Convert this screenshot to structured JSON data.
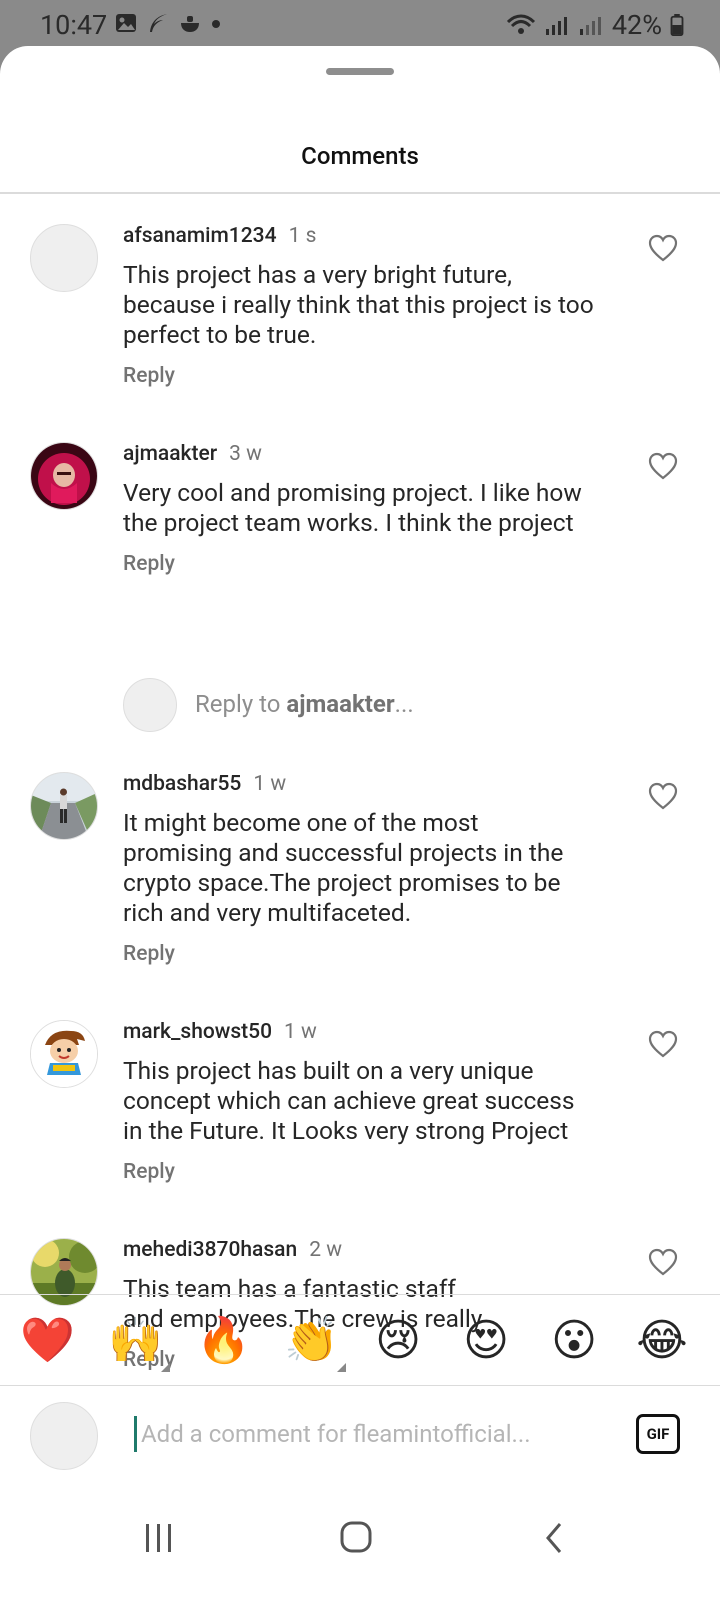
{
  "status_bar": {
    "time": "10:47",
    "battery": "42%"
  },
  "sheet": {
    "title": "Comments"
  },
  "comments": [
    {
      "username": "afsanamim1234",
      "age": "1 s",
      "lines": [
        "This project has a very bright future,",
        "because i really think that this project is too",
        "perfect to be true."
      ],
      "reply_label": "Reply",
      "avatar": "blank-avatar"
    },
    {
      "username": "ajmaakter",
      "age": "3 w",
      "lines": [
        "Very cool and promising project. I like how",
        "the project team works. I think the project"
      ],
      "reply_label": "Reply",
      "avatar": "hijab-avatar"
    },
    {
      "username": "mdbashar55",
      "age": "1 w",
      "lines": [
        "It might become one of the most",
        "promising and successful projects in the",
        "crypto space.The project promises to be",
        "rich and very multifaceted."
      ],
      "reply_label": "Reply",
      "avatar": "road-photo-avatar"
    },
    {
      "username": "mark_showst50",
      "age": "1 w",
      "lines": [
        "This project has built on a very unique",
        "concept which can achieve great success",
        "in the Future. It Looks very strong Project"
      ],
      "reply_label": "Reply",
      "avatar": "cartoon-boy-avatar"
    },
    {
      "username": "mehedi3870hasan",
      "age": "2 w",
      "lines": [
        "This team has a fantastic staff",
        "and employees.The crew is really"
      ],
      "reply_label": "Reply",
      "avatar": "nature-photo-avatar"
    }
  ],
  "reply_to": {
    "prefix": "Reply to ",
    "username": "ajmaakter",
    "suffix": "..."
  },
  "emoji_bar": [
    "❤️",
    "🙌",
    "🔥",
    "👏",
    "😢",
    "😍",
    "😮",
    "😂"
  ],
  "comment_input": {
    "placeholder": "Add a comment for fleamintofficial...",
    "gif_label": "GIF"
  },
  "colors": {
    "text": "#262626",
    "secondary": "#737373",
    "accent_cursor": "#1f7a6b",
    "heart_outline": "#737373"
  }
}
